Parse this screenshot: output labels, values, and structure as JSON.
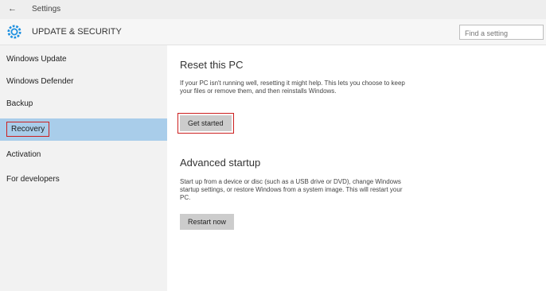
{
  "window": {
    "back_glyph": "←",
    "title": "Settings"
  },
  "header": {
    "title": "UPDATE & SECURITY",
    "search_placeholder": "Find a setting"
  },
  "sidebar": {
    "items": [
      {
        "label": "Windows Update"
      },
      {
        "label": "Windows Defender"
      },
      {
        "label": "Backup"
      },
      {
        "label": "Recovery"
      },
      {
        "label": "Activation"
      },
      {
        "label": "For developers"
      }
    ]
  },
  "main": {
    "section1": {
      "title": "Reset this PC",
      "description": "If your PC isn't running well, resetting it might help. This lets you choose to keep your files or remove them, and then reinstalls Windows.",
      "button_label": "Get started"
    },
    "section2": {
      "title": "Advanced startup",
      "description": "Start up from a device or disc (such as a USB drive or DVD), change Windows startup settings, or restore Windows from a system image. This will restart your PC.",
      "button_label": "Restart now"
    }
  },
  "colors": {
    "accent": "#a9cdea",
    "highlight": "#cc1f1f",
    "gear": "#1e90e0"
  }
}
